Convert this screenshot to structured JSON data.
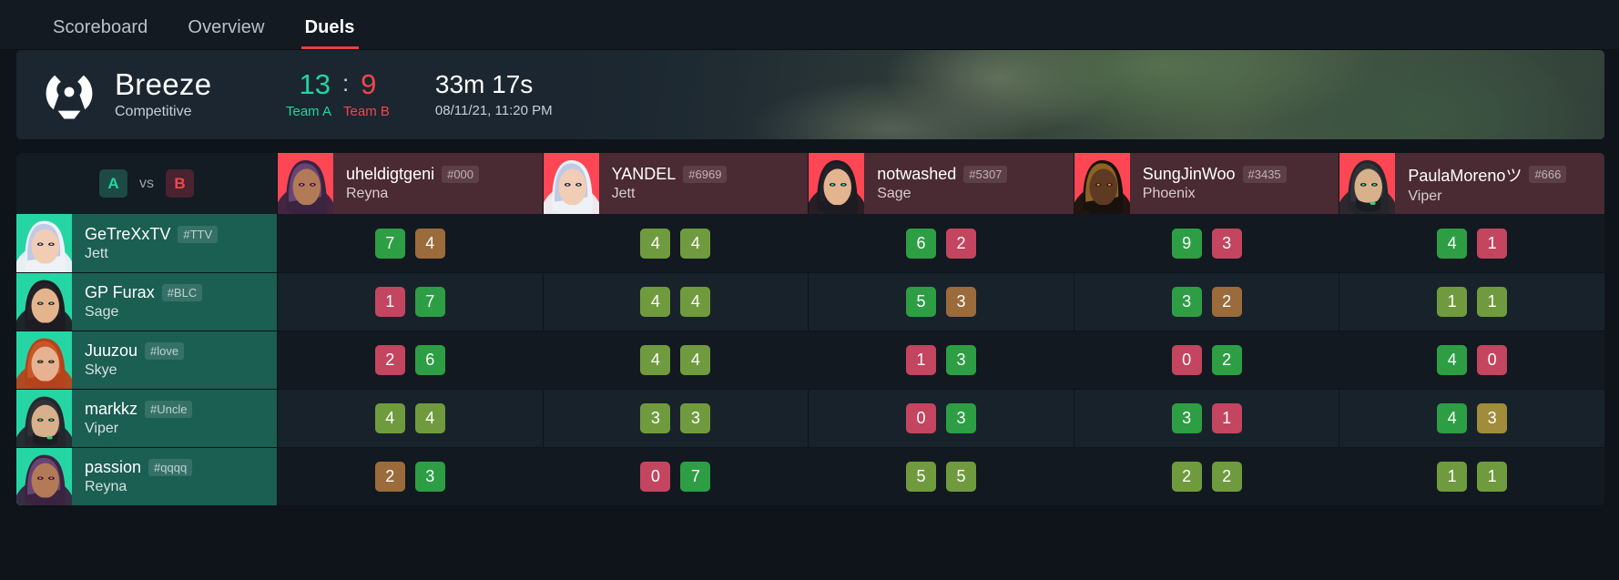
{
  "tabs": [
    {
      "label": "Scoreboard",
      "active": false
    },
    {
      "label": "Overview",
      "active": false
    },
    {
      "label": "Duels",
      "active": true
    }
  ],
  "match": {
    "map": "Breeze",
    "mode": "Competitive",
    "score_a": "13",
    "score_separator": ":",
    "score_b": "9",
    "team_a_label": "Team A",
    "team_b_label": "Team B",
    "duration": "33m 17s",
    "date": "08/11/21, 11:20 PM"
  },
  "grid": {
    "team_a_badge": "A",
    "vs_label": "vs",
    "team_b_badge": "B",
    "opponents": [
      {
        "name": "uheldigtgeni",
        "tag": "#000",
        "agent": "Reyna"
      },
      {
        "name": "YANDEL",
        "tag": "#6969",
        "agent": "Jett"
      },
      {
        "name": "notwashed",
        "tag": "#5307",
        "agent": "Sage"
      },
      {
        "name": "SungJinWoo",
        "tag": "#3435",
        "agent": "Phoenix"
      },
      {
        "name": "PaulaMorenoツ",
        "tag": "#666",
        "agent": "Viper"
      }
    ],
    "players": [
      {
        "name": "GeTreXxTV",
        "tag": "#TTV",
        "agent": "Jett"
      },
      {
        "name": "GP Furax",
        "tag": "#BLC",
        "agent": "Sage"
      },
      {
        "name": "Juuzou",
        "tag": "#love",
        "agent": "Skye"
      },
      {
        "name": "markkz",
        "tag": "#Uncle",
        "agent": "Viper"
      },
      {
        "name": "passion",
        "tag": "#qqqq",
        "agent": "Reyna"
      }
    ],
    "duels": [
      [
        {
          "left": "7",
          "left_color": "green",
          "right": "4",
          "right_color": "brown"
        },
        {
          "left": "4",
          "left_color": "olive",
          "right": "4",
          "right_color": "olive"
        },
        {
          "left": "6",
          "left_color": "green",
          "right": "2",
          "right_color": "red"
        },
        {
          "left": "9",
          "left_color": "green",
          "right": "3",
          "right_color": "red"
        },
        {
          "left": "4",
          "left_color": "green",
          "right": "1",
          "right_color": "red"
        }
      ],
      [
        {
          "left": "1",
          "left_color": "red",
          "right": "7",
          "right_color": "green"
        },
        {
          "left": "4",
          "left_color": "olive",
          "right": "4",
          "right_color": "olive"
        },
        {
          "left": "5",
          "left_color": "green",
          "right": "3",
          "right_color": "brown"
        },
        {
          "left": "3",
          "left_color": "green",
          "right": "2",
          "right_color": "brown"
        },
        {
          "left": "1",
          "left_color": "olive",
          "right": "1",
          "right_color": "olive"
        }
      ],
      [
        {
          "left": "2",
          "left_color": "red",
          "right": "6",
          "right_color": "green"
        },
        {
          "left": "4",
          "left_color": "olive",
          "right": "4",
          "right_color": "olive"
        },
        {
          "left": "1",
          "left_color": "red",
          "right": "3",
          "right_color": "green"
        },
        {
          "left": "0",
          "left_color": "red",
          "right": "2",
          "right_color": "green"
        },
        {
          "left": "4",
          "left_color": "green",
          "right": "0",
          "right_color": "red"
        }
      ],
      [
        {
          "left": "4",
          "left_color": "olive",
          "right": "4",
          "right_color": "olive"
        },
        {
          "left": "3",
          "left_color": "olive",
          "right": "3",
          "right_color": "olive"
        },
        {
          "left": "0",
          "left_color": "red",
          "right": "3",
          "right_color": "green"
        },
        {
          "left": "3",
          "left_color": "green",
          "right": "1",
          "right_color": "red"
        },
        {
          "left": "4",
          "left_color": "green",
          "right": "3",
          "right_color": "khaki"
        }
      ],
      [
        {
          "left": "2",
          "left_color": "brown",
          "right": "3",
          "right_color": "green"
        },
        {
          "left": "0",
          "left_color": "red",
          "right": "7",
          "right_color": "green"
        },
        {
          "left": "5",
          "left_color": "olive",
          "right": "5",
          "right_color": "olive"
        },
        {
          "left": "2",
          "left_color": "olive",
          "right": "2",
          "right_color": "olive"
        },
        {
          "left": "1",
          "left_color": "olive",
          "right": "1",
          "right_color": "olive"
        }
      ]
    ]
  },
  "colors": {
    "green": "#2d9e44",
    "olive": "#6f9b3e",
    "khaki": "#a08c3a",
    "brown": "#9b6b3c",
    "red": "#c4455f",
    "accent_red": "#e8413f",
    "team_a": "#1fd6a0",
    "team_b": "#f0484b",
    "agent_tile": "#ff4655"
  },
  "icons": {
    "map_logo": "valorant-map-logo-icon"
  }
}
